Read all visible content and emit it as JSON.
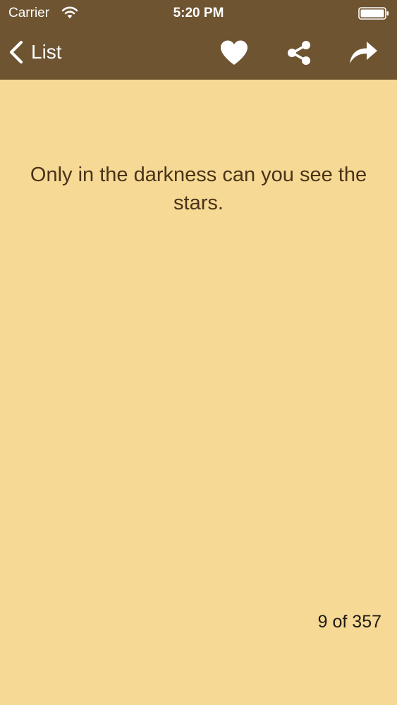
{
  "status_bar": {
    "carrier": "Carrier",
    "time": "5:20 PM"
  },
  "nav": {
    "back_label": "List",
    "icons": {
      "back": "chevron-left-icon",
      "favorite": "heart-icon",
      "share": "share-icon",
      "forward": "forward-arrow-icon"
    }
  },
  "quote": {
    "text": "Only in the darkness can you see the stars."
  },
  "pagination": {
    "text": "9 of 357",
    "current": 9,
    "total": 357
  },
  "colors": {
    "nav_background": "#6e5431",
    "page_background": "#f5d995",
    "quote_text": "#4a3318",
    "icon": "#ffffff"
  }
}
